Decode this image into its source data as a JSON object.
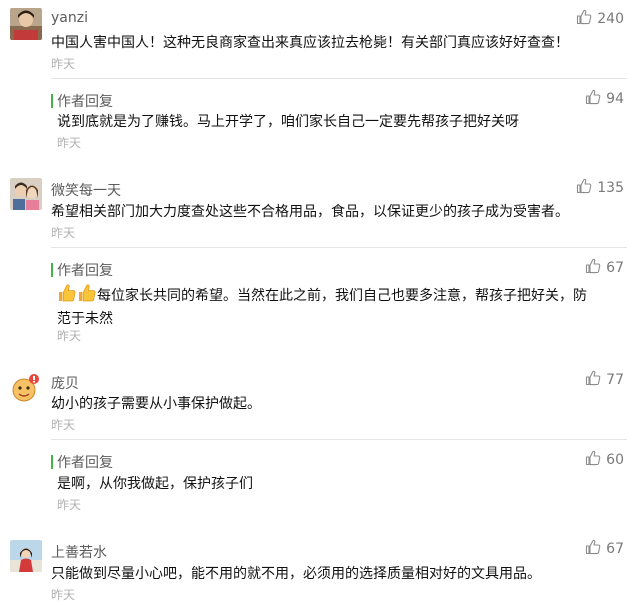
{
  "colors": {
    "reply_accent": "#44b549",
    "name": "#5c5c5c",
    "time": "#b2b2b2",
    "like_icon": "#8c8c8c"
  },
  "icons": {
    "like": "thumbs-up-icon"
  },
  "comments": [
    {
      "name": "yanzi",
      "likes": "240",
      "text": "中国人害中国人！这种无良商家查出来真应该拉去枪毙！有关部门真应该好好查查！",
      "time": "昨天",
      "reply": {
        "label": "作者回复",
        "likes": "94",
        "text": "说到底就是为了赚钱。马上开学了，咱们家长自己一定要先帮孩子把好关呀",
        "time": "昨天"
      }
    },
    {
      "name": "微笑每一天",
      "likes": "135",
      "text": "希望相关部门加大力度查处这些不合格用品，食品，以保证更少的孩子成为受害者。",
      "time": "昨天",
      "reply": {
        "label": "作者回复",
        "likes": "67",
        "text_line1": "每位家长共同的希望。当然在此之前，我们自己也要多注意，帮孩子把好关，防",
        "text_line2": "范于未然",
        "time": "昨天"
      }
    },
    {
      "name": "庞贝",
      "likes": "77",
      "text": "幼小的孩子需要从小事保护做起。",
      "time": "昨天",
      "reply": {
        "label": "作者回复",
        "likes": "60",
        "text": "是啊，从你我做起，保护孩子们",
        "time": "昨天"
      }
    },
    {
      "name": "上善若水",
      "likes": "67",
      "text": "只能做到尽量小心吧，能不用的就不用，必须用的选择质量相对好的文具用品。",
      "time": "昨天"
    }
  ]
}
